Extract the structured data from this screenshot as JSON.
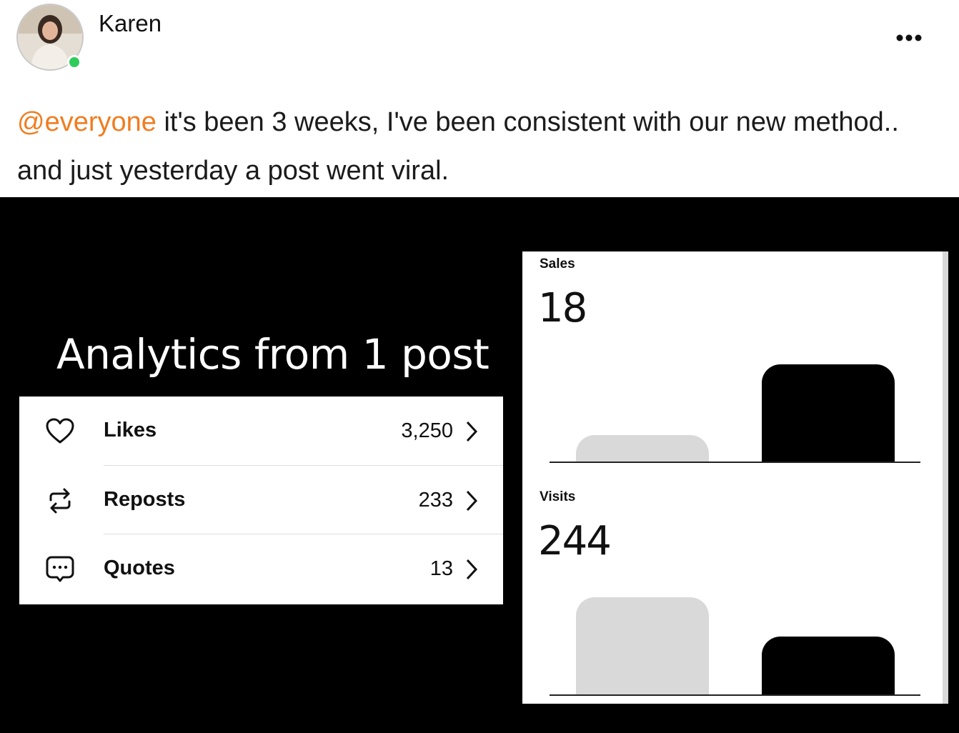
{
  "post": {
    "author": "Karen",
    "mention": "@everyone",
    "text": " it's been 3 weeks, I've been consistent with our new method.. and just yesterday a post went viral.",
    "more_icon": "more-horizontal-icon"
  },
  "image": {
    "heading": "Analytics from 1 post",
    "stats": [
      {
        "label": "Likes",
        "value": "3,250",
        "icon": "heart-icon"
      },
      {
        "label": "Reposts",
        "value": "233",
        "icon": "repost-icon"
      },
      {
        "label": "Quotes",
        "value": "13",
        "icon": "quote-bubble-icon"
      }
    ]
  },
  "chart_data": [
    {
      "type": "bar",
      "title": "Sales",
      "headline_value": "18",
      "categories": [
        "",
        ""
      ],
      "values": [
        0.28,
        1.0
      ],
      "colors": [
        "#d9d9d9",
        "#000000"
      ]
    },
    {
      "type": "bar",
      "title": "Visits",
      "headline_value": "244",
      "categories": [
        "",
        ""
      ],
      "values": [
        1.0,
        0.6
      ],
      "colors": [
        "#d9d9d9",
        "#000000"
      ]
    }
  ],
  "colors": {
    "mention": "#f07d21",
    "online": "#2ecc5b"
  }
}
